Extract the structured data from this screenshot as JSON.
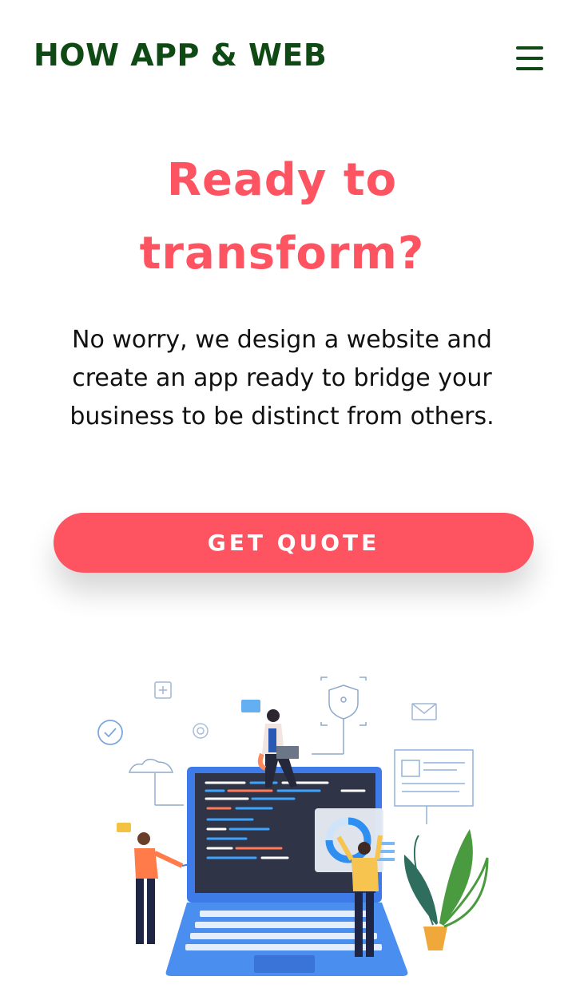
{
  "header": {
    "brand": "HOW APP & WEB",
    "menu_icon": "hamburger-menu-icon",
    "brand_color": "#0f4a14"
  },
  "hero": {
    "title_line1": "Ready to",
    "title_line2": "transform?",
    "description": "No worry, we design a website and create an app ready to bridge your business to be distinct from others.",
    "cta_label": "GET QUOTE",
    "accent_color": "#fe5361"
  },
  "illustration": {
    "icons": [
      "plus-card-icon",
      "check-circle-icon",
      "gear-icon",
      "chat-bubble-icon",
      "shield-icon",
      "mail-icon",
      "cloud-icon",
      "document-card-icon",
      "donut-chart-icon",
      "plant-icon",
      "laptop-icon"
    ]
  }
}
